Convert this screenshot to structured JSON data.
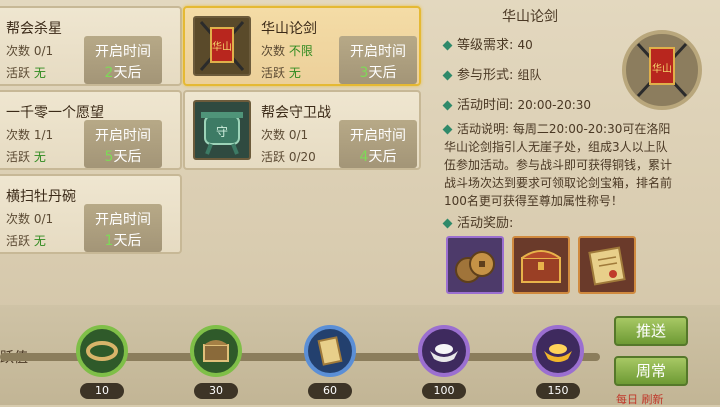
{
  "events": [
    {
      "title": "帮会杀星",
      "count_label": "次数",
      "count": "0/1",
      "active_label": "活跃",
      "active": "无",
      "time_label": "开启时间",
      "days_num": "2",
      "days_unit": "天后"
    },
    {
      "title": "华山论剑",
      "count_label": "次数",
      "count": "不限",
      "active_label": "活跃",
      "active": "无",
      "time_label": "开启时间",
      "days_num": "3",
      "days_unit": "天后"
    },
    {
      "title": "一千零一个愿望",
      "count_label": "次数",
      "count": "1/1",
      "active_label": "活跃",
      "active": "无",
      "time_label": "开启时间",
      "days_num": "5",
      "days_unit": "天后"
    },
    {
      "title": "帮会守卫战",
      "count_label": "次数",
      "count": "0/1",
      "active_label": "活跃",
      "active": "0/20",
      "time_label": "开启时间",
      "days_num": "4",
      "days_unit": "天后"
    },
    {
      "title": "横扫牡丹碗",
      "count_label": "次数",
      "count": "0/1",
      "active_label": "活跃",
      "active": "无",
      "time_label": "开启时间",
      "days_num": "1",
      "days_unit": "天后"
    }
  ],
  "detail": {
    "title": "华山论剑",
    "level_label": "等级需求:",
    "level": "40",
    "mode_label": "参与形式:",
    "mode": "组队",
    "time_label": "活动时间:",
    "time": "20:00-20:30",
    "desc_label": "活动说明:",
    "desc": "每周二20:00-20:30可在洛阳华山论剑指引人无崖子处，组成3人以上队伍参加活动。参与战斗即可获得铜钱，累计战斗场次达到要求可领取论剑宝箱，排名前100名更可获得至尊加属性称号！",
    "reward_label": "活动奖励:"
  },
  "activity": {
    "label": "跃值",
    "milestones": [
      "10",
      "30",
      "60",
      "100",
      "150"
    ],
    "daily_refresh": "每日",
    "daily_refresh_2": "刷新"
  },
  "buttons": {
    "push": "推送",
    "weekly": "周常"
  },
  "emblem_text": "华山",
  "guard_text": "守"
}
